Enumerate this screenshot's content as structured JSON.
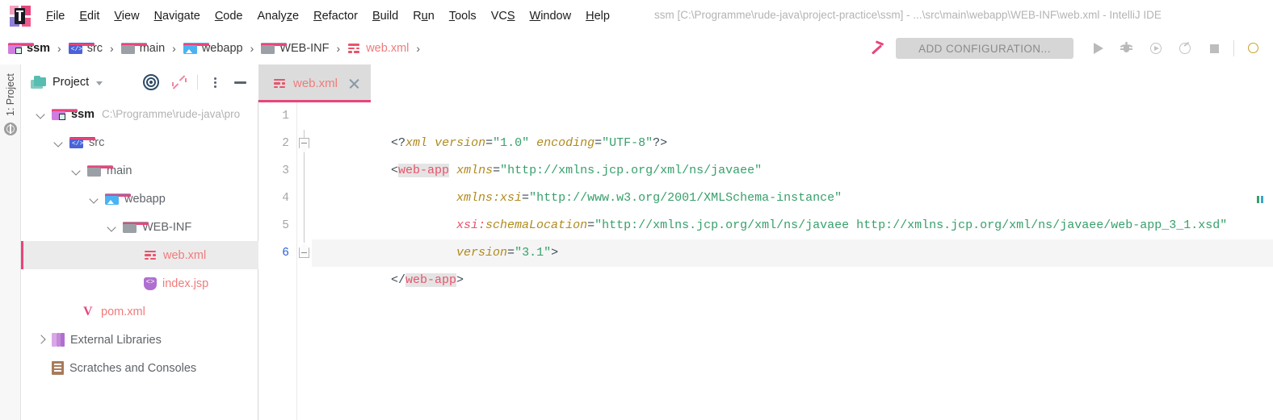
{
  "window": {
    "title": "ssm [C:\\Programme\\rude-java\\project-practice\\ssm] - ...\\src\\main\\webapp\\WEB-INF\\web.xml - IntelliJ IDE"
  },
  "menubar": {
    "logo_name": "intellij-idea-logo",
    "items": [
      {
        "label": "File",
        "mnemonic": "F"
      },
      {
        "label": "Edit",
        "mnemonic": "E"
      },
      {
        "label": "View",
        "mnemonic": "V"
      },
      {
        "label": "Navigate",
        "mnemonic": "N"
      },
      {
        "label": "Code",
        "mnemonic": "C"
      },
      {
        "label": "Analyze",
        "mnemonic": "z"
      },
      {
        "label": "Refactor",
        "mnemonic": "R"
      },
      {
        "label": "Build",
        "mnemonic": "B"
      },
      {
        "label": "Run",
        "mnemonic": "u"
      },
      {
        "label": "Tools",
        "mnemonic": "T"
      },
      {
        "label": "VCS",
        "mnemonic": "S"
      },
      {
        "label": "Window",
        "mnemonic": "W"
      },
      {
        "label": "Help",
        "mnemonic": "H"
      }
    ]
  },
  "navbar": {
    "breadcrumbs": [
      {
        "label": "ssm",
        "icon": "module-folder-icon"
      },
      {
        "label": "src",
        "icon": "source-folder-icon"
      },
      {
        "label": "main",
        "icon": "folder-icon"
      },
      {
        "label": "webapp",
        "icon": "web-folder-icon"
      },
      {
        "label": "WEB-INF",
        "icon": "folder-icon"
      },
      {
        "label": "web.xml",
        "icon": "xml-file-icon"
      }
    ],
    "separator": "›",
    "run_config": {
      "label": "ADD CONFIGURATION...",
      "hammer_icon": "build-hammer-icon"
    },
    "toolbar_icons": [
      "run-icon",
      "debug-icon",
      "run-with-coverage-icon",
      "profiler-icon",
      "stop-icon",
      "search-everywhere-icon"
    ]
  },
  "tool_stripe": {
    "label": "1: Project",
    "structure_icon": "structure-icon"
  },
  "project_panel": {
    "title": "Project",
    "title_icon": "project-icon",
    "chevron": "chevron-down-icon",
    "actions": [
      "select-opened-file-icon",
      "collapse-all-icon",
      "options-menu-icon",
      "hide-panel-icon"
    ],
    "tree": [
      {
        "label": "ssm",
        "path": "C:\\Programme\\rude-java\\pro",
        "icon": "module-folder-icon",
        "depth": 0,
        "twisty": "open",
        "bold": true,
        "selected": false,
        "type": "folder"
      },
      {
        "label": "src",
        "path": "",
        "icon": "source-folder-icon",
        "depth": 1,
        "twisty": "open",
        "bold": false,
        "selected": false,
        "type": "folder"
      },
      {
        "label": "main",
        "path": "",
        "icon": "folder-icon",
        "depth": 2,
        "twisty": "open",
        "bold": false,
        "selected": false,
        "type": "folder"
      },
      {
        "label": "webapp",
        "path": "",
        "icon": "web-folder-icon",
        "depth": 3,
        "twisty": "open",
        "bold": false,
        "selected": false,
        "type": "folder"
      },
      {
        "label": "WEB-INF",
        "path": "",
        "icon": "folder-icon",
        "depth": 4,
        "twisty": "open",
        "bold": false,
        "selected": false,
        "type": "folder"
      },
      {
        "label": "web.xml",
        "path": "",
        "icon": "xml-file-icon",
        "depth": 5,
        "twisty": "none",
        "bold": false,
        "selected": true,
        "type": "file"
      },
      {
        "label": "index.jsp",
        "path": "",
        "icon": "jsp-file-icon",
        "depth": 5,
        "twisty": "none",
        "bold": false,
        "selected": false,
        "type": "file"
      },
      {
        "label": "pom.xml",
        "path": "",
        "icon": "maven-file-icon",
        "depth": 2,
        "twisty": "none",
        "bold": false,
        "selected": false,
        "type": "file"
      },
      {
        "label": "External Libraries",
        "path": "",
        "icon": "libraries-icon",
        "depth": 0,
        "twisty": "closed",
        "bold": false,
        "selected": false,
        "type": "node"
      },
      {
        "label": "Scratches and Consoles",
        "path": "",
        "icon": "scratches-icon",
        "depth": 0,
        "twisty": "none",
        "bold": false,
        "selected": false,
        "type": "node"
      }
    ]
  },
  "editor": {
    "tabs": [
      {
        "label": "web.xml",
        "icon": "xml-file-icon",
        "close": "close-icon",
        "active": true
      }
    ],
    "current_line": 6,
    "gutter_line_numbers": [
      "1",
      "2",
      "3",
      "4",
      "5",
      "6"
    ],
    "lines": [
      {
        "number": "1",
        "fold": "none",
        "tokens": [
          {
            "t": "<?",
            "c": "punc"
          },
          {
            "t": "xml",
            "c": "pi"
          },
          {
            "t": " ",
            "c": "plain"
          },
          {
            "t": "version",
            "c": "attr"
          },
          {
            "t": "=",
            "c": "punc"
          },
          {
            "t": "\"1.0\"",
            "c": "val"
          },
          {
            "t": " ",
            "c": "plain"
          },
          {
            "t": "encoding",
            "c": "attr"
          },
          {
            "t": "=",
            "c": "punc"
          },
          {
            "t": "\"UTF-8\"",
            "c": "val"
          },
          {
            "t": "?>",
            "c": "punc"
          }
        ]
      },
      {
        "number": "2",
        "fold": "open",
        "tokens": [
          {
            "t": "<",
            "c": "punc"
          },
          {
            "t": "web-app",
            "c": "tag-hl"
          },
          {
            "t": " ",
            "c": "plain"
          },
          {
            "t": "xmlns",
            "c": "attr"
          },
          {
            "t": "=",
            "c": "punc"
          },
          {
            "t": "\"http://xmlns.jcp.org/xml/ns/javaee\"",
            "c": "val"
          }
        ]
      },
      {
        "number": "3",
        "fold": "none",
        "tokens": [
          {
            "t": "         ",
            "c": "plain"
          },
          {
            "t": "xmlns:xsi",
            "c": "attr"
          },
          {
            "t": "=",
            "c": "punc"
          },
          {
            "t": "\"http://www.w3.org/2001/XMLSchema-instance\"",
            "c": "val"
          }
        ]
      },
      {
        "number": "4",
        "fold": "none",
        "tokens": [
          {
            "t": "         ",
            "c": "plain"
          },
          {
            "t": "xsi:",
            "c": "ns"
          },
          {
            "t": "schemaLocation",
            "c": "attr"
          },
          {
            "t": "=",
            "c": "punc"
          },
          {
            "t": "\"http://xmlns.jcp.org/xml/ns/javaee http://xmlns.jcp.org/xml/ns/javaee/web-app_3_1.xsd\"",
            "c": "val"
          }
        ]
      },
      {
        "number": "5",
        "fold": "none",
        "tokens": [
          {
            "t": "         ",
            "c": "plain"
          },
          {
            "t": "version",
            "c": "attr"
          },
          {
            "t": "=",
            "c": "punc"
          },
          {
            "t": "\"3.1\"",
            "c": "val"
          },
          {
            "t": ">",
            "c": "punc"
          }
        ]
      },
      {
        "number": "6",
        "fold": "close",
        "current": true,
        "tokens": [
          {
            "t": "</",
            "c": "punc"
          },
          {
            "t": "web-app",
            "c": "tag-hl"
          },
          {
            "t": ">",
            "c": "punc"
          }
        ]
      }
    ]
  },
  "colors": {
    "accent_pink": "#e8457c",
    "file_label": "#f07b7b",
    "xml_tag": "#e8546a",
    "xml_attr": "#b08a1e",
    "xml_value": "#37a06b",
    "selection_bg": "#ebebeb",
    "tab_bg": "#dcdcdc",
    "current_line_bg": "#f5f5f5"
  }
}
